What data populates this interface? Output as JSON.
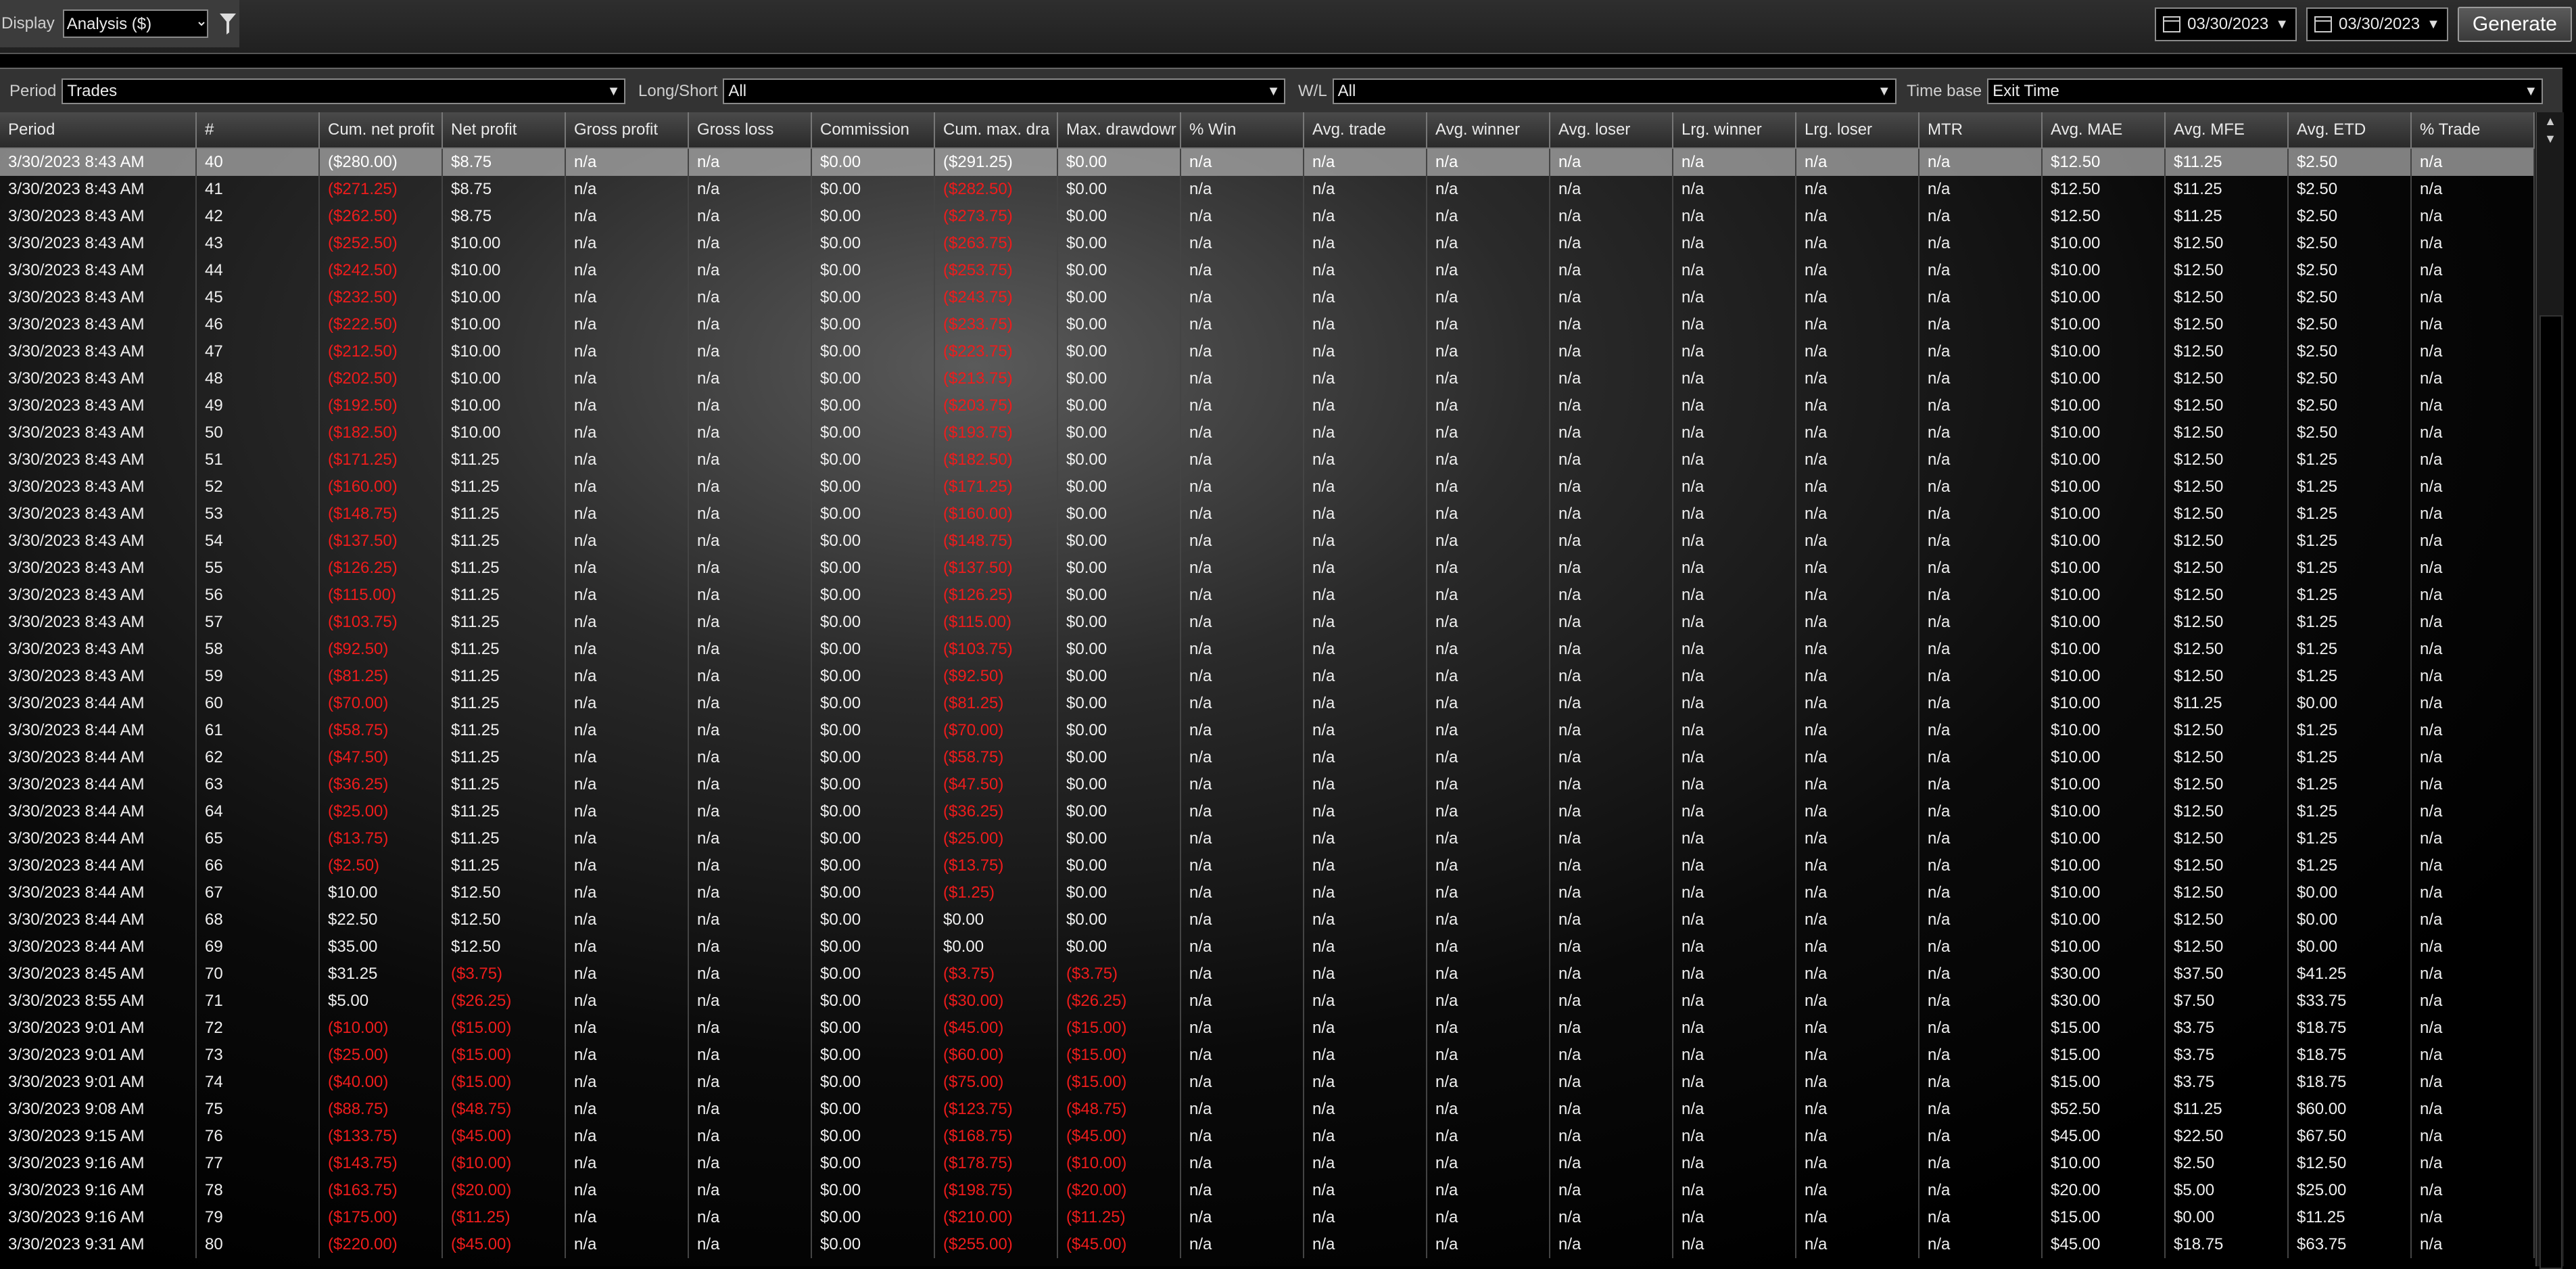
{
  "toolbar": {
    "display_label": "Display",
    "display_value": "Analysis ($)",
    "date_from": "03/30/2023",
    "date_to": "03/30/2023",
    "generate_label": "Generate"
  },
  "filters": {
    "period_label": "Period",
    "period_value": "Trades",
    "longshort_label": "Long/Short",
    "longshort_value": "All",
    "wl_label": "W/L",
    "wl_value": "All",
    "timebase_label": "Time base",
    "timebase_value": "Exit Time"
  },
  "columns": [
    "Period",
    "#",
    "Cum. net profit",
    "Net profit",
    "Gross profit",
    "Gross loss",
    "Commission",
    "Cum. max. dra",
    "Max. drawdowr",
    "% Win",
    "Avg. trade",
    "Avg. winner",
    "Avg. loser",
    "Lrg. winner",
    "Lrg. loser",
    "MTR",
    "Avg. MAE",
    "Avg. MFE",
    "Avg. ETD",
    "% Trade"
  ],
  "colors": {
    "negative": "#ee1c1c",
    "selected_row": "#aaaaaa"
  },
  "rows": [
    [
      "3/30/2023 8:43 AM",
      "40",
      "($280.00)",
      "$8.75",
      "$0.00",
      "($291.25)",
      "$0.00",
      "$12.50",
      "$11.25",
      "$2.50"
    ],
    [
      "3/30/2023 8:43 AM",
      "41",
      "($271.25)",
      "$8.75",
      "$0.00",
      "($282.50)",
      "$0.00",
      "$12.50",
      "$11.25",
      "$2.50"
    ],
    [
      "3/30/2023 8:43 AM",
      "42",
      "($262.50)",
      "$8.75",
      "$0.00",
      "($273.75)",
      "$0.00",
      "$12.50",
      "$11.25",
      "$2.50"
    ],
    [
      "3/30/2023 8:43 AM",
      "43",
      "($252.50)",
      "$10.00",
      "$0.00",
      "($263.75)",
      "$0.00",
      "$10.00",
      "$12.50",
      "$2.50"
    ],
    [
      "3/30/2023 8:43 AM",
      "44",
      "($242.50)",
      "$10.00",
      "$0.00",
      "($253.75)",
      "$0.00",
      "$10.00",
      "$12.50",
      "$2.50"
    ],
    [
      "3/30/2023 8:43 AM",
      "45",
      "($232.50)",
      "$10.00",
      "$0.00",
      "($243.75)",
      "$0.00",
      "$10.00",
      "$12.50",
      "$2.50"
    ],
    [
      "3/30/2023 8:43 AM",
      "46",
      "($222.50)",
      "$10.00",
      "$0.00",
      "($233.75)",
      "$0.00",
      "$10.00",
      "$12.50",
      "$2.50"
    ],
    [
      "3/30/2023 8:43 AM",
      "47",
      "($212.50)",
      "$10.00",
      "$0.00",
      "($223.75)",
      "$0.00",
      "$10.00",
      "$12.50",
      "$2.50"
    ],
    [
      "3/30/2023 8:43 AM",
      "48",
      "($202.50)",
      "$10.00",
      "$0.00",
      "($213.75)",
      "$0.00",
      "$10.00",
      "$12.50",
      "$2.50"
    ],
    [
      "3/30/2023 8:43 AM",
      "49",
      "($192.50)",
      "$10.00",
      "$0.00",
      "($203.75)",
      "$0.00",
      "$10.00",
      "$12.50",
      "$2.50"
    ],
    [
      "3/30/2023 8:43 AM",
      "50",
      "($182.50)",
      "$10.00",
      "$0.00",
      "($193.75)",
      "$0.00",
      "$10.00",
      "$12.50",
      "$2.50"
    ],
    [
      "3/30/2023 8:43 AM",
      "51",
      "($171.25)",
      "$11.25",
      "$0.00",
      "($182.50)",
      "$0.00",
      "$10.00",
      "$12.50",
      "$1.25"
    ],
    [
      "3/30/2023 8:43 AM",
      "52",
      "($160.00)",
      "$11.25",
      "$0.00",
      "($171.25)",
      "$0.00",
      "$10.00",
      "$12.50",
      "$1.25"
    ],
    [
      "3/30/2023 8:43 AM",
      "53",
      "($148.75)",
      "$11.25",
      "$0.00",
      "($160.00)",
      "$0.00",
      "$10.00",
      "$12.50",
      "$1.25"
    ],
    [
      "3/30/2023 8:43 AM",
      "54",
      "($137.50)",
      "$11.25",
      "$0.00",
      "($148.75)",
      "$0.00",
      "$10.00",
      "$12.50",
      "$1.25"
    ],
    [
      "3/30/2023 8:43 AM",
      "55",
      "($126.25)",
      "$11.25",
      "$0.00",
      "($137.50)",
      "$0.00",
      "$10.00",
      "$12.50",
      "$1.25"
    ],
    [
      "3/30/2023 8:43 AM",
      "56",
      "($115.00)",
      "$11.25",
      "$0.00",
      "($126.25)",
      "$0.00",
      "$10.00",
      "$12.50",
      "$1.25"
    ],
    [
      "3/30/2023 8:43 AM",
      "57",
      "($103.75)",
      "$11.25",
      "$0.00",
      "($115.00)",
      "$0.00",
      "$10.00",
      "$12.50",
      "$1.25"
    ],
    [
      "3/30/2023 8:43 AM",
      "58",
      "($92.50)",
      "$11.25",
      "$0.00",
      "($103.75)",
      "$0.00",
      "$10.00",
      "$12.50",
      "$1.25"
    ],
    [
      "3/30/2023 8:43 AM",
      "59",
      "($81.25)",
      "$11.25",
      "$0.00",
      "($92.50)",
      "$0.00",
      "$10.00",
      "$12.50",
      "$1.25"
    ],
    [
      "3/30/2023 8:44 AM",
      "60",
      "($70.00)",
      "$11.25",
      "$0.00",
      "($81.25)",
      "$0.00",
      "$10.00",
      "$11.25",
      "$0.00"
    ],
    [
      "3/30/2023 8:44 AM",
      "61",
      "($58.75)",
      "$11.25",
      "$0.00",
      "($70.00)",
      "$0.00",
      "$10.00",
      "$12.50",
      "$1.25"
    ],
    [
      "3/30/2023 8:44 AM",
      "62",
      "($47.50)",
      "$11.25",
      "$0.00",
      "($58.75)",
      "$0.00",
      "$10.00",
      "$12.50",
      "$1.25"
    ],
    [
      "3/30/2023 8:44 AM",
      "63",
      "($36.25)",
      "$11.25",
      "$0.00",
      "($47.50)",
      "$0.00",
      "$10.00",
      "$12.50",
      "$1.25"
    ],
    [
      "3/30/2023 8:44 AM",
      "64",
      "($25.00)",
      "$11.25",
      "$0.00",
      "($36.25)",
      "$0.00",
      "$10.00",
      "$12.50",
      "$1.25"
    ],
    [
      "3/30/2023 8:44 AM",
      "65",
      "($13.75)",
      "$11.25",
      "$0.00",
      "($25.00)",
      "$0.00",
      "$10.00",
      "$12.50",
      "$1.25"
    ],
    [
      "3/30/2023 8:44 AM",
      "66",
      "($2.50)",
      "$11.25",
      "$0.00",
      "($13.75)",
      "$0.00",
      "$10.00",
      "$12.50",
      "$1.25"
    ],
    [
      "3/30/2023 8:44 AM",
      "67",
      "$10.00",
      "$12.50",
      "$0.00",
      "($1.25)",
      "$0.00",
      "$10.00",
      "$12.50",
      "$0.00"
    ],
    [
      "3/30/2023 8:44 AM",
      "68",
      "$22.50",
      "$12.50",
      "$0.00",
      "$0.00",
      "$0.00",
      "$10.00",
      "$12.50",
      "$0.00"
    ],
    [
      "3/30/2023 8:44 AM",
      "69",
      "$35.00",
      "$12.50",
      "$0.00",
      "$0.00",
      "$0.00",
      "$10.00",
      "$12.50",
      "$0.00"
    ],
    [
      "3/30/2023 8:45 AM",
      "70",
      "$31.25",
      "($3.75)",
      "$0.00",
      "($3.75)",
      "($3.75)",
      "$30.00",
      "$37.50",
      "$41.25"
    ],
    [
      "3/30/2023 8:55 AM",
      "71",
      "$5.00",
      "($26.25)",
      "$0.00",
      "($30.00)",
      "($26.25)",
      "$30.00",
      "$7.50",
      "$33.75"
    ],
    [
      "3/30/2023 9:01 AM",
      "72",
      "($10.00)",
      "($15.00)",
      "$0.00",
      "($45.00)",
      "($15.00)",
      "$15.00",
      "$3.75",
      "$18.75"
    ],
    [
      "3/30/2023 9:01 AM",
      "73",
      "($25.00)",
      "($15.00)",
      "$0.00",
      "($60.00)",
      "($15.00)",
      "$15.00",
      "$3.75",
      "$18.75"
    ],
    [
      "3/30/2023 9:01 AM",
      "74",
      "($40.00)",
      "($15.00)",
      "$0.00",
      "($75.00)",
      "($15.00)",
      "$15.00",
      "$3.75",
      "$18.75"
    ],
    [
      "3/30/2023 9:08 AM",
      "75",
      "($88.75)",
      "($48.75)",
      "$0.00",
      "($123.75)",
      "($48.75)",
      "$52.50",
      "$11.25",
      "$60.00"
    ],
    [
      "3/30/2023 9:15 AM",
      "76",
      "($133.75)",
      "($45.00)",
      "$0.00",
      "($168.75)",
      "($45.00)",
      "$45.00",
      "$22.50",
      "$67.50"
    ],
    [
      "3/30/2023 9:16 AM",
      "77",
      "($143.75)",
      "($10.00)",
      "$0.00",
      "($178.75)",
      "($10.00)",
      "$10.00",
      "$2.50",
      "$12.50"
    ],
    [
      "3/30/2023 9:16 AM",
      "78",
      "($163.75)",
      "($20.00)",
      "$0.00",
      "($198.75)",
      "($20.00)",
      "$20.00",
      "$5.00",
      "$25.00"
    ],
    [
      "3/30/2023 9:16 AM",
      "79",
      "($175.00)",
      "($11.25)",
      "$0.00",
      "($210.00)",
      "($11.25)",
      "$15.00",
      "$0.00",
      "$11.25"
    ],
    [
      "3/30/2023 9:31 AM",
      "80",
      "($220.00)",
      "($45.00)",
      "$0.00",
      "($255.00)",
      "($45.00)",
      "$45.00",
      "$18.75",
      "$63.75"
    ]
  ],
  "na": "n/a"
}
